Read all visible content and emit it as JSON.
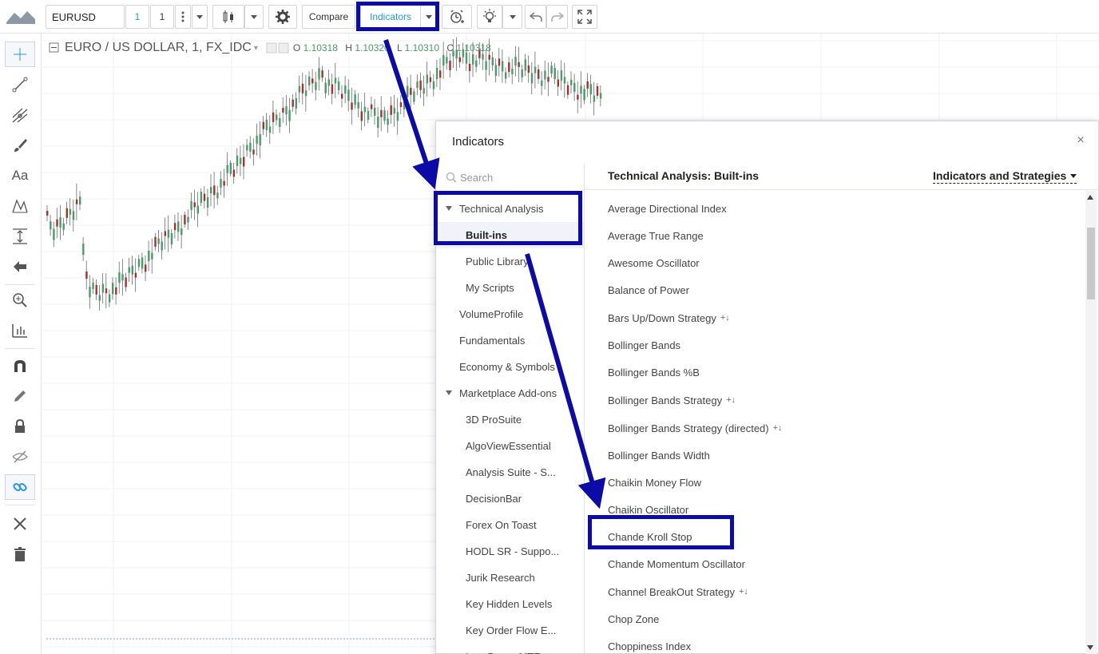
{
  "toolbar": {
    "symbol": "EURUSD",
    "interval_active": "1",
    "interval": "1",
    "compare_label": "Compare",
    "indicators_label": "Indicators"
  },
  "chart": {
    "title": "EURO / US DOLLAR, 1, FX_IDC",
    "ohlc": {
      "o_label": "O",
      "o": "1.10318",
      "h_label": "H",
      "h": "1.10320",
      "l_label": "L",
      "l": "1.10310",
      "c_label": "C",
      "c": "1.10318"
    }
  },
  "dialog": {
    "title": "Indicators",
    "close": "×",
    "search_placeholder": "Search",
    "header_title": "Technical Analysis: Built-ins",
    "filter_label": "Indicators and Strategies",
    "categories": [
      {
        "label": "Technical Analysis",
        "level": 0,
        "expanded": true
      },
      {
        "label": "Built-ins",
        "level": 1,
        "active": true
      },
      {
        "label": "Public Library",
        "level": 1
      },
      {
        "label": "My Scripts",
        "level": 1
      },
      {
        "label": "VolumeProfile",
        "level": 0
      },
      {
        "label": "Fundamentals",
        "level": 0
      },
      {
        "label": "Economy & Symbols",
        "level": 0
      },
      {
        "label": "Marketplace Add-ons",
        "level": 0,
        "expanded": true
      },
      {
        "label": "3D ProSuite",
        "level": 1
      },
      {
        "label": "AlgoViewEssential",
        "level": 1
      },
      {
        "label": "Analysis Suite - S...",
        "level": 1
      },
      {
        "label": "DecisionBar",
        "level": 1
      },
      {
        "label": "Forex On Toast",
        "level": 1
      },
      {
        "label": "HODL SR - Suppo...",
        "level": 1
      },
      {
        "label": "Jurik Research",
        "level": 1
      },
      {
        "label": "Key Hidden Levels",
        "level": 1
      },
      {
        "label": "Key Order Flow E...",
        "level": 1
      },
      {
        "label": "LazyBear - MTF...",
        "level": 1
      }
    ],
    "indicators": [
      {
        "label": "Average Directional Index",
        "strategy": false
      },
      {
        "label": "Average True Range",
        "strategy": false
      },
      {
        "label": "Awesome Oscillator",
        "strategy": false
      },
      {
        "label": "Balance of Power",
        "strategy": false
      },
      {
        "label": "Bars Up/Down Strategy",
        "strategy": true
      },
      {
        "label": "Bollinger Bands",
        "strategy": false
      },
      {
        "label": "Bollinger Bands %B",
        "strategy": false
      },
      {
        "label": "Bollinger Bands Strategy",
        "strategy": true
      },
      {
        "label": "Bollinger Bands Strategy (directed)",
        "strategy": true
      },
      {
        "label": "Bollinger Bands Width",
        "strategy": false
      },
      {
        "label": "Chaikin Money Flow",
        "strategy": false
      },
      {
        "label": "Chaikin Oscillator",
        "strategy": false
      },
      {
        "label": "Chande Kroll Stop",
        "strategy": false
      },
      {
        "label": "Chande Momentum Oscillator",
        "strategy": false
      },
      {
        "label": "Channel BreakOut Strategy",
        "strategy": true
      },
      {
        "label": "Chop Zone",
        "strategy": false
      },
      {
        "label": "Choppiness Index",
        "strategy": false
      }
    ],
    "strategy_glyph": "+↓"
  },
  "colors": {
    "annotation": "#0d0ba8",
    "up_candle": "#4a9a6a",
    "down_candle": "#a0332e",
    "accent": "#2196f3"
  },
  "icons": {
    "left_toolbar": [
      "crosshair-icon",
      "trend-line-icon",
      "pitchfork-icon",
      "brush-icon",
      "text-icon",
      "pattern-icon",
      "measure-icon",
      "arrow-left-icon",
      "zoom-icon",
      "ruler-icon",
      "magnet-icon",
      "pencil-lock-icon",
      "lock-icon",
      "eye-hide-icon",
      "link-icon",
      "tools-icon",
      "trash-icon"
    ]
  }
}
